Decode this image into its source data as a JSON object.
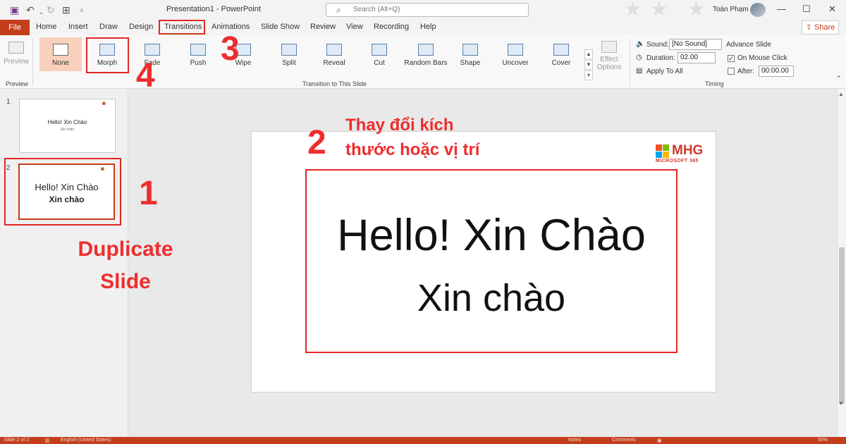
{
  "window": {
    "title": "Presentation1  -  PowerPoint",
    "search_placeholder": "Search (Alt+Q)",
    "user_name": "Toàn Phạm",
    "share_label": "Share"
  },
  "ribbon_tabs": [
    "File",
    "Home",
    "Insert",
    "Draw",
    "Design",
    "Transitions",
    "Animations",
    "Slide Show",
    "Review",
    "View",
    "Recording",
    "Help"
  ],
  "ribbon": {
    "preview_label": "Preview",
    "preview_group": "Preview",
    "transitions": [
      "None",
      "Morph",
      "Fade",
      "Push",
      "Wipe",
      "Split",
      "Reveal",
      "Cut",
      "Random Bars",
      "Shape",
      "Uncover",
      "Cover"
    ],
    "effect_options": "Effect Options",
    "transitions_group": "Transition to This Slide",
    "timing": {
      "sound_label": "Sound:",
      "sound_value": "[No Sound]",
      "duration_label": "Duration:",
      "duration_value": "02.00",
      "apply_all": "Apply To All",
      "advance_label": "Advance Slide",
      "on_mouse_click": "On Mouse Click",
      "after_label": "After:",
      "after_value": "00:00.00",
      "group": "Timing"
    }
  },
  "slides_panel": {
    "slide1": {
      "number": "1",
      "title": "Hello! Xin Chào",
      "subtitle": "Xin chào"
    },
    "slide2": {
      "number": "2",
      "title": "Hello! Xin Chào",
      "subtitle": "Xin chào"
    }
  },
  "slide": {
    "line1": "Hello! Xin Chào",
    "line2": "Xin chào",
    "logo_text": "MHG",
    "logo_sub": "MICROSOFT 365"
  },
  "annotations": {
    "step1": "1",
    "step1_text_l1": "Duplicate",
    "step1_text_l2": "Slide",
    "step2": "2",
    "step2_text_l1": "Thay đổi kích",
    "step2_text_l2": "thước hoặc vị trí",
    "step3": "3",
    "step4": "4"
  },
  "status": {
    "slide_of": "Slide 2 of 2",
    "language": "English (United States)",
    "notes": "Notes",
    "comments": "Comments",
    "zoom": "56%"
  },
  "colors": {
    "accent": "#c43e1c",
    "annotation": "#ee2d2d"
  }
}
